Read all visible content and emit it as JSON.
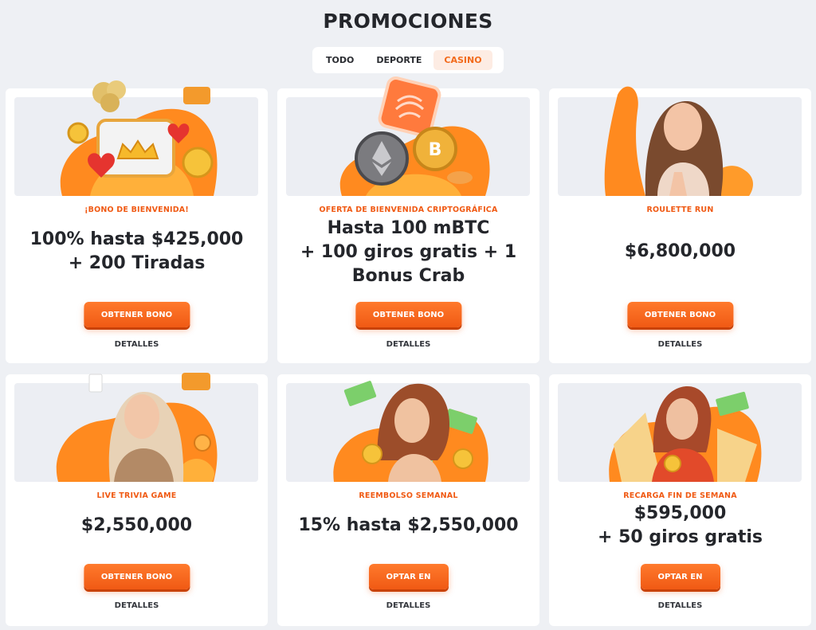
{
  "page": {
    "title": "PROMOCIONES"
  },
  "tabs": [
    {
      "label": "TODO",
      "active": false
    },
    {
      "label": "DEPORTE",
      "active": false
    },
    {
      "label": "CASINO",
      "active": true
    }
  ],
  "colors": {
    "accent": "#f05a14",
    "background": "#eef0f4",
    "card": "#ffffff",
    "text": "#24262b"
  },
  "promotions": [
    {
      "label": "¡BONO DE BIENVENIDA!",
      "amount_lines": [
        "100% hasta $425,000",
        "+ 200 Tiradas"
      ],
      "cta": "OBTENER BONO",
      "details": "DETALLES",
      "icon": "slot-machine-icon"
    },
    {
      "label": "OFERTA DE BIENVENIDA CRIPTOGRÁFICA",
      "amount_lines": [
        "Hasta 100 mBTC",
        "+ 100 giros gratis + 1",
        "Bonus Crab"
      ],
      "cta": "OBTENER BONO",
      "details": "DETALLES",
      "icon": "crypto-coins-icon"
    },
    {
      "label": "ROULETTE RUN",
      "amount_lines": [
        "$6,800,000"
      ],
      "cta": "OBTENER BONO",
      "details": "DETALLES",
      "icon": "dealer-woman-icon"
    },
    {
      "label": "LIVE TRIVIA GAME",
      "amount_lines": [
        "$2,550,000"
      ],
      "cta": "OBTENER BONO",
      "details": "DETALLES",
      "icon": "host-woman-icon"
    },
    {
      "label": "REEMBOLSO SEMANAL",
      "amount_lines": [
        "15% hasta $2,550,000"
      ],
      "cta": "OPTAR EN",
      "details": "DETALLES",
      "icon": "money-woman-icon"
    },
    {
      "label": "RECARGA FIN DE SEMANA",
      "amount_lines": [
        "$595,000",
        "+ 50 giros gratis"
      ],
      "cta": "OPTAR EN",
      "details": "DETALLES",
      "icon": "money-man-icon"
    }
  ]
}
